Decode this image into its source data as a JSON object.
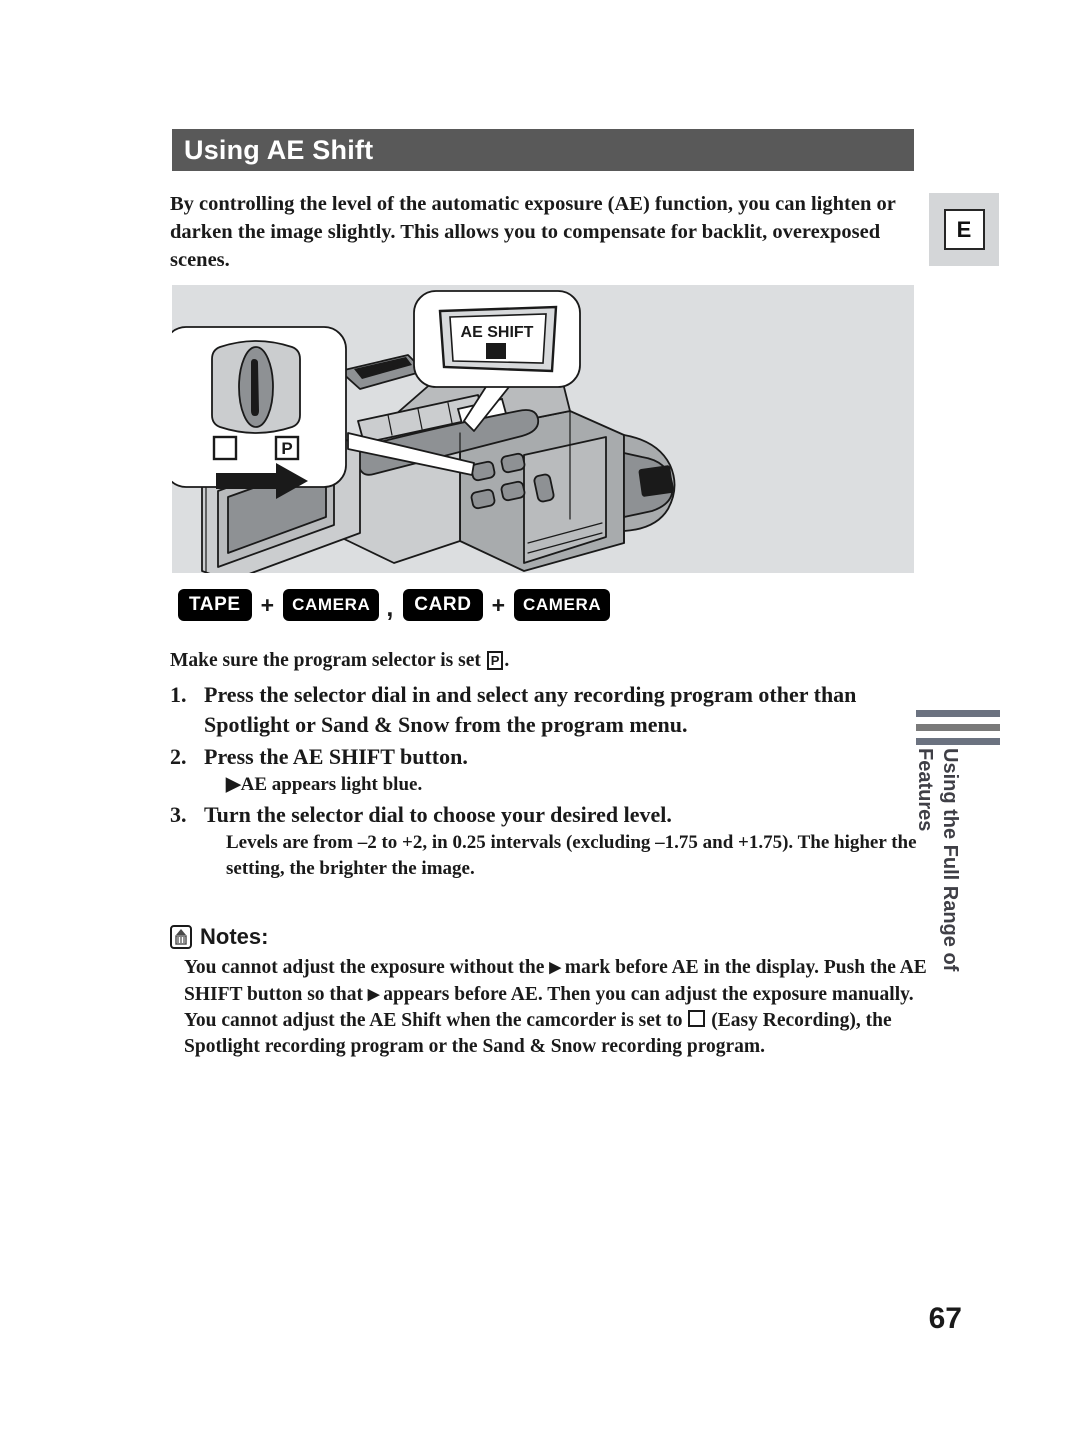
{
  "header": {
    "title": "Using AE Shift"
  },
  "edge_tab": {
    "letter": "E"
  },
  "intro": {
    "text": "By controlling the level of the automatic exposure (AE) function, you can lighten or darken the image slightly. This allows you to compensate for backlit, overexposed scenes."
  },
  "illustration": {
    "dial_callout": {
      "name": "program-selector-dial",
      "square_symbol": "□",
      "p_symbol": "P",
      "arrow": "→"
    },
    "display_callout": {
      "label": "AE SHIFT"
    },
    "device": "camcorder with open LCD panel"
  },
  "modes": {
    "items": [
      {
        "label": "TAPE",
        "size": "normal"
      },
      {
        "label": "CAMERA",
        "size": "small"
      },
      {
        "label": "CARD",
        "size": "normal"
      },
      {
        "label": "CAMERA",
        "size": "small"
      }
    ],
    "plus": "+",
    "comma": ","
  },
  "precheck": {
    "before": "Make sure the program selector is set ",
    "glyph": "P",
    "after": "."
  },
  "steps": [
    {
      "num": "1.",
      "text": "Press the selector dial in and select any recording program other than Spotlight or Sand & Snow from the program menu.",
      "sub": "",
      "detail": ""
    },
    {
      "num": "2.",
      "text": "Press the AE SHIFT button.",
      "sub": "▶AE appears light blue.",
      "detail": ""
    },
    {
      "num": "3.",
      "text": "Turn the selector dial to choose your desired level.",
      "sub": "",
      "detail": "Levels are from –2 to +2, in 0.25 intervals (excluding –1.75 and +1.75). The higher the setting, the brighter the image."
    }
  ],
  "notes": {
    "title": "Notes:",
    "items": [
      {
        "part1": "You cannot adjust the exposure without the ",
        "glyph": "▶",
        "part2": " mark before AE in the display. Push the AE SHIFT button so that ",
        "glyph2": "▶",
        "part3": " appears before AE. Then you can adjust the exposure manually."
      },
      {
        "part1": "You cannot adjust the AE Shift when the camcorder is set to ",
        "glyph": "□",
        "part2": " (Easy Recording), the Spotlight recording program or the Sand & Snow recording program."
      }
    ]
  },
  "side_tab": {
    "label": "Using the Full Range of Features"
  },
  "page_number": "67"
}
